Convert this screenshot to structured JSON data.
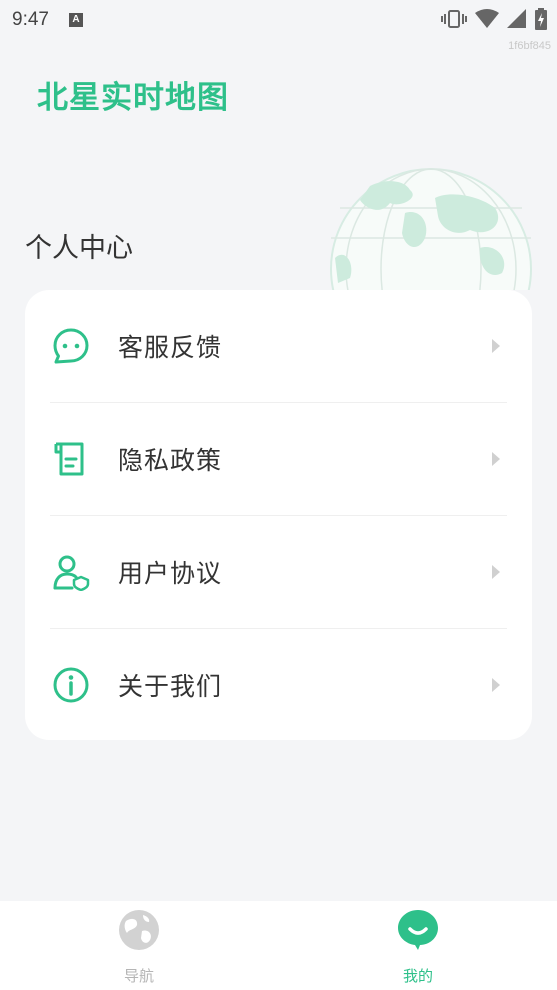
{
  "status_bar": {
    "time": "9:47",
    "notification_letter": "A"
  },
  "build_id": "1f6bf845",
  "app": {
    "logo_text": "北星实时地图"
  },
  "page": {
    "title": "个人中心"
  },
  "menu": {
    "items": [
      {
        "label": "客服反馈",
        "icon": "chat-icon"
      },
      {
        "label": "隐私政策",
        "icon": "scroll-icon"
      },
      {
        "label": "用户协议",
        "icon": "user-shield-icon"
      },
      {
        "label": "关于我们",
        "icon": "info-icon"
      }
    ]
  },
  "bottom_nav": {
    "tabs": [
      {
        "label": "导航",
        "icon": "globe-icon",
        "active": false
      },
      {
        "label": "我的",
        "icon": "smile-chat-icon",
        "active": true
      }
    ]
  },
  "colors": {
    "accent": "#2ec08a",
    "background": "#f4f5f7",
    "card": "#ffffff"
  }
}
